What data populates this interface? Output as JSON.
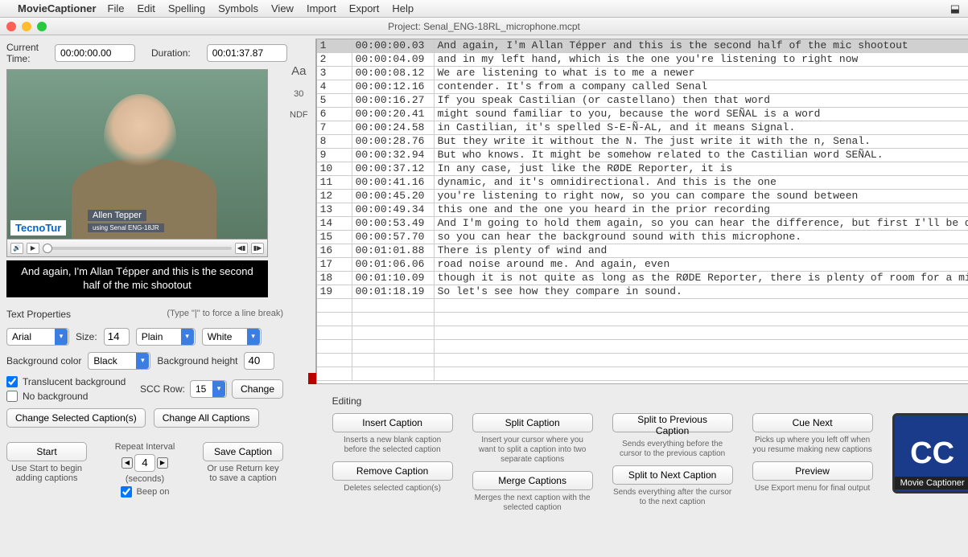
{
  "menubar": {
    "appname": "MovieCaptioner",
    "items": [
      "File",
      "Edit",
      "Spelling",
      "Symbols",
      "View",
      "Import",
      "Export",
      "Help"
    ]
  },
  "window_title": "Project: Senal_ENG-18RL_microphone.mcpt",
  "times": {
    "current_label": "Current Time:",
    "current": "00:00:00.00",
    "duration_label": "Duration:",
    "duration": "00:01:37.87"
  },
  "video": {
    "logo": "TecnoTur",
    "name_overlay": "Allen Tepper",
    "sub_overlay": "using Senal ENG-18JR"
  },
  "caption_preview": "And again, I'm Allan Tépper and this is the second half of the mic shootout",
  "text_properties": {
    "heading": "Text Properties",
    "hint": "(Type \"|\" to force a line break)",
    "font": "Arial",
    "size_label": "Size:",
    "size": "14",
    "style": "Plain",
    "color": "White",
    "bgcolor_label": "Background color",
    "bgcolor": "Black",
    "bgheight_label": "Background height",
    "bgheight": "40",
    "translucent": "Translucent background",
    "nobg": "No background",
    "sccrow_label": "SCC Row:",
    "sccrow": "15",
    "change": "Change",
    "change_selected": "Change Selected Caption(s)",
    "change_all": "Change All Captions"
  },
  "repeat": {
    "label": "Repeat Interval",
    "value": "4",
    "unit": "(seconds)",
    "start": "Start",
    "start_hint": "Use Start to begin adding captions",
    "beep": "Beep on",
    "save": "Save Caption",
    "save_hint": "Or use Return key to save a caption"
  },
  "mid": {
    "aa": "Aa",
    "ndf_num": "30",
    "ndf": "NDF"
  },
  "captions": [
    {
      "n": "1",
      "tc": "00:00:00.03",
      "t": "And again, I'm Allan Tépper and this is the second half of the mic shootout"
    },
    {
      "n": "2",
      "tc": "00:00:04.09",
      "t": "and in my left hand, which is the one you're listening to right now"
    },
    {
      "n": "3",
      "tc": "00:00:08.12",
      "t": "We are listening to what is to me a newer"
    },
    {
      "n": "4",
      "tc": "00:00:12.16",
      "t": "contender. It's from a company called Senal"
    },
    {
      "n": "5",
      "tc": "00:00:16.27",
      "t": "If you speak Castilian (or castellano) then that word"
    },
    {
      "n": "6",
      "tc": "00:00:20.41",
      "t": "might sound familiar to you, because the word SEÑAL is a word"
    },
    {
      "n": "7",
      "tc": "00:00:24.58",
      "t": "in Castilian, it's spelled S-E-Ñ-AL, and it means Signal."
    },
    {
      "n": "8",
      "tc": "00:00:28.76",
      "t": "But they write it without the N. The just write it with the n, Senal."
    },
    {
      "n": "9",
      "tc": "00:00:32.94",
      "t": "But who knows. It might be somehow related to the Castilian word SEÑAL."
    },
    {
      "n": "10",
      "tc": "00:00:37.12",
      "t": "In any case, just like the RØDE Reporter, it is"
    },
    {
      "n": "11",
      "tc": "00:00:41.16",
      "t": "dynamic, and it's omnidirectional. And this is the one"
    },
    {
      "n": "12",
      "tc": "00:00:45.20",
      "t": "you're listening to right now, so you can compare the sound between"
    },
    {
      "n": "13",
      "tc": "00:00:49.34",
      "t": "this one and the one you heard in the prior recording"
    },
    {
      "n": "14",
      "tc": "00:00:53.49",
      "t": "And I'm going to hold them again, so you can hear the difference, but first I'll be quiet"
    },
    {
      "n": "15",
      "tc": "00:00:57.70",
      "t": "so you can hear the background sound with this microphone."
    },
    {
      "n": "16",
      "tc": "00:01:01.88",
      "t": "There is plenty of wind and"
    },
    {
      "n": "17",
      "tc": "00:01:06.06",
      "t": "road noise around me. And again, even"
    },
    {
      "n": "18",
      "tc": "00:01:10.09",
      "t": "though it is not quite as long as the RØDE Reporter, there is plenty of room for a mic..."
    },
    {
      "n": "19",
      "tc": "00:01:18.19",
      "t": "So let's see how they compare in sound."
    }
  ],
  "editing": {
    "heading": "Editing",
    "cells": {
      "insert": {
        "label": "Insert Caption",
        "desc": "Inserts a new blank caption before the selected caption"
      },
      "split": {
        "label": "Split Caption",
        "desc": "Insert your cursor where you want to split a caption into two separate captions"
      },
      "split_prev": {
        "label": "Split to Previous Caption",
        "desc": "Sends everything before the cursor to the previous caption"
      },
      "cue": {
        "label": "Cue Next",
        "desc": "Picks up where you left off when you resume making new captions"
      },
      "remove": {
        "label": "Remove Caption",
        "desc": "Deletes selected caption(s)"
      },
      "merge": {
        "label": "Merge Captions",
        "desc": "Merges the next caption with the selected caption"
      },
      "split_next": {
        "label": "Split to Next Caption",
        "desc": "Sends everything after the cursor to the next caption"
      },
      "preview": {
        "label": "Preview",
        "desc": "Use Export menu for final output"
      }
    },
    "logo": {
      "cc": "CC",
      "name": "Movie Captioner"
    }
  }
}
